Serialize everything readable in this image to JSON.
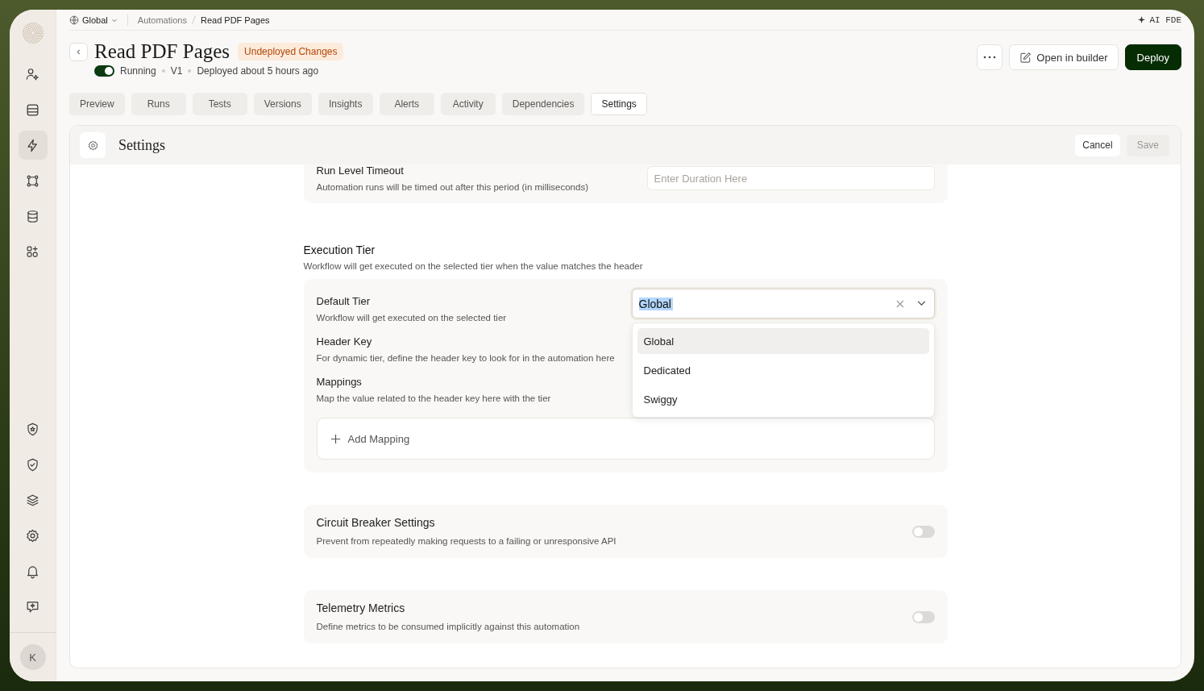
{
  "breadcrumb": {
    "workspace": "Global",
    "items": [
      "Automations",
      "Read PDF Pages"
    ]
  },
  "ai_button": {
    "label": "AI FDE"
  },
  "sidebar": {
    "top": [
      {
        "kind": "user",
        "selected": false
      },
      {
        "kind": "inbox",
        "selected": false
      },
      {
        "kind": "bolt",
        "selected": true
      },
      {
        "kind": "nodes",
        "selected": false
      },
      {
        "kind": "database",
        "selected": false
      },
      {
        "kind": "apps",
        "selected": false
      }
    ],
    "bottom": [
      {
        "kind": "shield-star",
        "selected": false
      },
      {
        "kind": "shield-check",
        "selected": false
      },
      {
        "kind": "layers",
        "selected": false
      },
      {
        "kind": "gear",
        "selected": false
      },
      {
        "kind": "bell",
        "selected": false
      },
      {
        "kind": "chat",
        "selected": false
      }
    ],
    "avatar": "K"
  },
  "header": {
    "title": "Read PDF Pages",
    "badge": "Undeployed Changes",
    "running": true,
    "status": "Running",
    "version": "V1",
    "deployed": "Deployed about 5 hours ago"
  },
  "actions": {
    "open": "Open in builder",
    "deploy": "Deploy"
  },
  "tabs": [
    {
      "label": "Preview",
      "selected": false
    },
    {
      "label": "Runs",
      "selected": false
    },
    {
      "label": "Tests",
      "selected": false
    },
    {
      "label": "Versions",
      "selected": false
    },
    {
      "label": "Insights",
      "selected": false
    },
    {
      "label": "Alerts",
      "selected": false
    },
    {
      "label": "Activity",
      "selected": false
    },
    {
      "label": "Dependencies",
      "selected": false
    },
    {
      "label": "Settings",
      "selected": true
    }
  ],
  "panel": {
    "title": "Settings",
    "cancel": "Cancel",
    "save": "Save",
    "save_disabled": true
  },
  "timeout": {
    "label": "Run Level Timeout",
    "description": "Automation runs will be timed out after this period (in milliseconds)",
    "placeholder": "Enter Duration Here"
  },
  "execution_tier": {
    "title": "Execution Tier",
    "description": "Workflow will get executed on the selected tier when the value matches the header",
    "fields": [
      {
        "label": "Default Tier",
        "description": "Workflow will get executed on the selected tier"
      },
      {
        "label": "Header Key",
        "description": "For dynamic tier, define the header key to look for in the automation here"
      },
      {
        "label": "Mappings",
        "description": "Map the value related to the header key here with the tier"
      }
    ],
    "select": {
      "value": "Global",
      "expanded": true,
      "options": [
        {
          "label": "Global",
          "selected": true
        },
        {
          "label": "Dedicated",
          "selected": false
        },
        {
          "label": "Swiggy",
          "selected": false
        }
      ]
    },
    "add_mapping": "Add Mapping"
  },
  "toggles": [
    {
      "title": "Circuit Breaker Settings",
      "description": "Prevent from repeatedly making requests to a failing or unresponsive API",
      "on": false
    },
    {
      "title": "Telemetry Metrics",
      "description": "Define metrics to be consumed implicitly against this automation",
      "on": false
    }
  ]
}
